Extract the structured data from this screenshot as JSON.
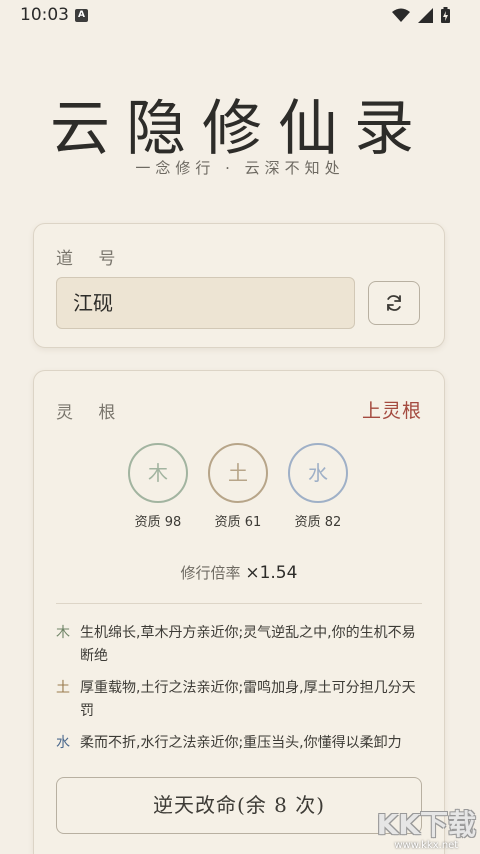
{
  "status": {
    "time": "10:03",
    "badge": "A"
  },
  "app": {
    "title": "云隐修仙录",
    "subtitle": "一念修行 · 云深不知处"
  },
  "name_card": {
    "label": "道 号",
    "value": "江砚"
  },
  "root_card": {
    "label": "灵 根",
    "grade": "上灵根",
    "roots": [
      {
        "element": "木",
        "aptitude": "资质 98",
        "color": "#a2b4a0"
      },
      {
        "element": "土",
        "aptitude": "资质 61",
        "color": "#b7a589"
      },
      {
        "element": "水",
        "aptitude": "资质 82",
        "color": "#9fb0c7"
      }
    ],
    "multiplier_label": "修行倍率",
    "multiplier_value": "×1.54",
    "traits": [
      {
        "element": "木",
        "element_color": "#6f8466",
        "text": "生机绵长,草木丹方亲近你;灵气逆乱之中,你的生机不易断绝"
      },
      {
        "element": "土",
        "element_color": "#9a7b4f",
        "text": "厚重载物,土行之法亲近你;雷鸣加身,厚土可分担几分天罚"
      },
      {
        "element": "水",
        "element_color": "#4d6a8e",
        "text": "柔而不折,水行之法亲近你;重压当头,你懂得以柔卸力"
      }
    ],
    "action_button": "逆天改命(余 8 次)"
  },
  "watermark": {
    "big": "KK下载",
    "small": "www.kkx.net"
  }
}
